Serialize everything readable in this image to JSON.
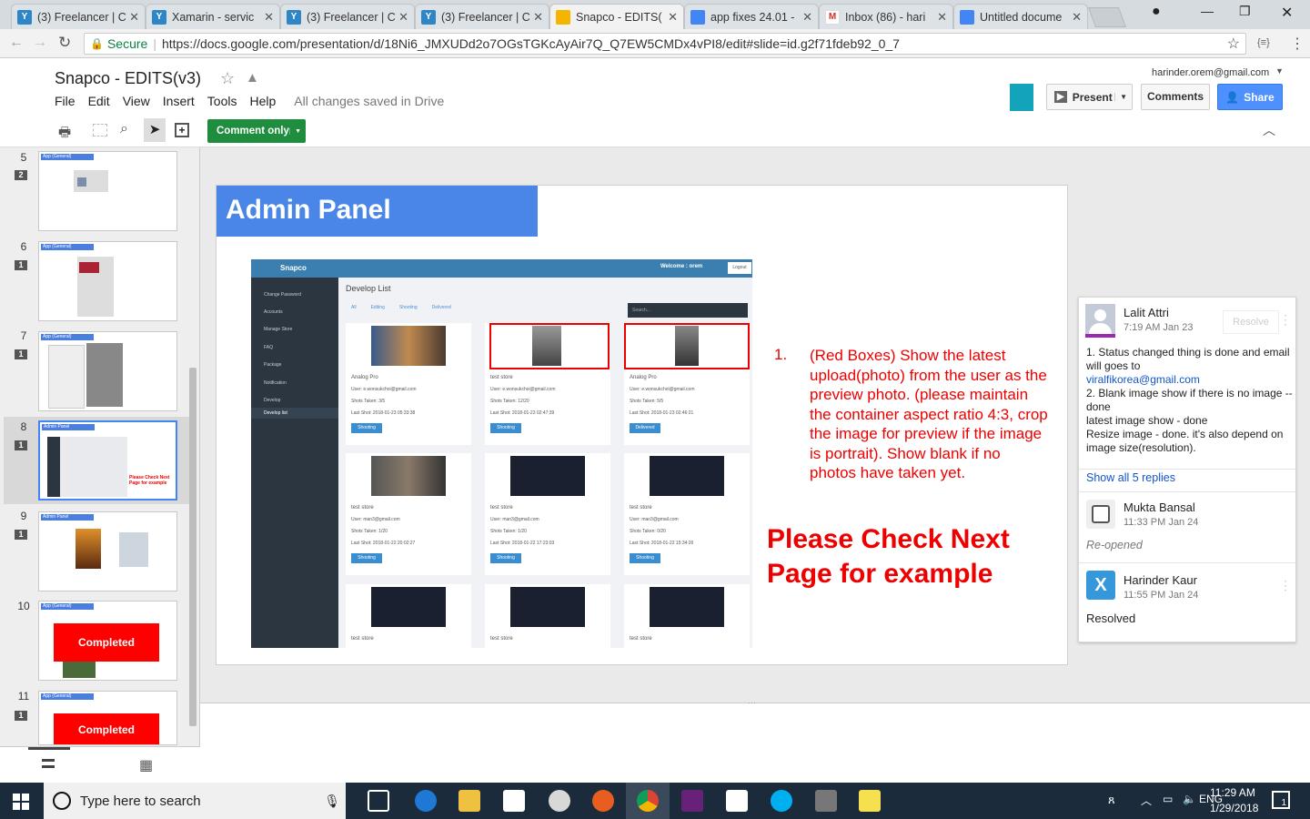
{
  "browser": {
    "tabs": [
      {
        "label": "(3) Freelancer | C",
        "icon": "freelancer-icon",
        "color": "#2f86c7"
      },
      {
        "label": "Xamarin - servic",
        "icon": "freelancer-icon",
        "color": "#2f86c7"
      },
      {
        "label": "(3) Freelancer | C",
        "icon": "freelancer-icon",
        "color": "#2f86c7"
      },
      {
        "label": "(3) Freelancer | C",
        "icon": "freelancer-icon",
        "color": "#2f86c7"
      },
      {
        "label": "Snapco - EDITS(",
        "icon": "slides-icon",
        "color": "#f4b400"
      },
      {
        "label": "app fixes 24.01 -",
        "icon": "docs-icon",
        "color": "#4285f4"
      },
      {
        "label": "Inbox (86) - hari",
        "icon": "gmail-icon",
        "color": "#d93025"
      },
      {
        "label": "Untitled docume",
        "icon": "docs-icon",
        "color": "#4285f4"
      }
    ],
    "secure_label": "Secure",
    "url": "https://docs.google.com/presentation/d/18Ni6_JMXUDd2o7OGsTGKcAyAir7Q_Q7EW5CMDx4vPI8/edit#slide=id.g2f71fdeb92_0_7"
  },
  "doc": {
    "title": "Snapco - EDITS(v3)",
    "menu": [
      "File",
      "Edit",
      "View",
      "Insert",
      "Tools",
      "Help"
    ],
    "save_status": "All changes saved in Drive",
    "account": "harinder.orem@gmail.com",
    "present_label": "Present",
    "comments_label": "Comments",
    "share_label": "Share",
    "mode_label": "Comment only"
  },
  "filmstrip": [
    {
      "num": "5",
      "comments": "2",
      "header": "App (General)",
      "text": ""
    },
    {
      "num": "6",
      "comments": "1",
      "header": "App (General)",
      "text": ""
    },
    {
      "num": "7",
      "comments": "1",
      "header": "App (General)",
      "text": ""
    },
    {
      "num": "8",
      "comments": "1",
      "header": "Admin Panel",
      "text": "Please Check Next Page for example"
    },
    {
      "num": "9",
      "comments": "1",
      "header": "Admin Panel",
      "text": ""
    },
    {
      "num": "10",
      "comments": "",
      "header": "App (General)",
      "text": "Completed"
    },
    {
      "num": "11",
      "comments": "1",
      "header": "App (General)",
      "text": "Completed"
    }
  ],
  "slide": {
    "title": "Admin Panel",
    "list_number": "1.",
    "note_text": "(Red Boxes) Show the latest upload(photo) from the user as the preview photo. (please maintain the container aspect ratio 4:3, crop the image for preview if the image is portrait). Show blank if no photos have taken yet.",
    "callout": "Please Check Next Page for example",
    "mock": {
      "brand": "Snapco",
      "welcome": "Welcome : orem",
      "logout": "Logout",
      "page_title": "Develop List",
      "search_placeholder": "Search...",
      "filters": [
        "All",
        "Editing",
        "Shooting",
        "Delivered"
      ],
      "sidebar": [
        "Change Password",
        "Accounts",
        "Manage Store",
        "FAQ",
        "Package",
        "Notification",
        "Develop",
        "Develop list"
      ],
      "cards": [
        {
          "store": "Analog Pro",
          "user": "User: e.wonsukchoi@gmail.com",
          "shots": "Shots Taken: 3/5",
          "last": "Last Shot: 2018-01-23 05:33:38",
          "button": "Shooting"
        },
        {
          "store": "test store",
          "user": "User: e.wonsukchoi@gmail.com",
          "shots": "Shots Taken: 12/20",
          "last": "Last Shot: 2018-01-23 02:47:39",
          "button": "Shooting"
        },
        {
          "store": "Analog Pro",
          "user": "User: e.wonsukchoi@gmail.com",
          "shots": "Shots Taken: 5/5",
          "last": "Last Shot: 2018-01-23 02:46:21",
          "button": "Delivered"
        },
        {
          "store": "test store",
          "user": "User: man3@gmail.com",
          "shots": "Shots Taken: 1/20",
          "last": "Last Shot: 2018-01-22 20:02:27",
          "button": "Shooting"
        },
        {
          "store": "test store",
          "user": "User: man3@gmail.com",
          "shots": "Shots Taken: 1/20",
          "last": "Last Shot: 2018-01-22 17:23:03",
          "button": "Shooting"
        },
        {
          "store": "test store",
          "user": "User: man3@gmail.com",
          "shots": "Shots Taken: 0/20",
          "last": "Last Shot: 2018-01-22 15:34:26",
          "button": "Shooting"
        },
        {
          "store": "test store",
          "user": "",
          "shots": "",
          "last": "",
          "button": ""
        },
        {
          "store": "test store",
          "user": "",
          "shots": "",
          "last": "",
          "button": ""
        },
        {
          "store": "test store",
          "user": "",
          "shots": "",
          "last": "",
          "button": ""
        }
      ]
    }
  },
  "comment": {
    "author": "Lalit Attri",
    "time": "7:19 AM Jan 23",
    "resolve_label": "Resolve",
    "body_1": "1. Status changed thing is done and email will goes to",
    "email": "viralfikorea@gmail.com",
    "body_2": "2. Blank image show if there is no image -- done",
    "body_3": "latest image show - done",
    "body_4": "Resize image - done. it's also depend on image size(resolution).",
    "show_replies": "Show all 5 replies",
    "reply1_author": "Mukta Bansal",
    "reply1_time": "11:33 PM Jan 24",
    "reply1_text": "Re-opened",
    "reply2_author": "Harinder Kaur",
    "reply2_time": "11:55 PM Jan 24",
    "reply2_text": "Resolved"
  },
  "taskbar": {
    "search_placeholder": "Type here to search",
    "time": "11:29 AM",
    "date": "1/29/2018",
    "notifications": "1"
  }
}
